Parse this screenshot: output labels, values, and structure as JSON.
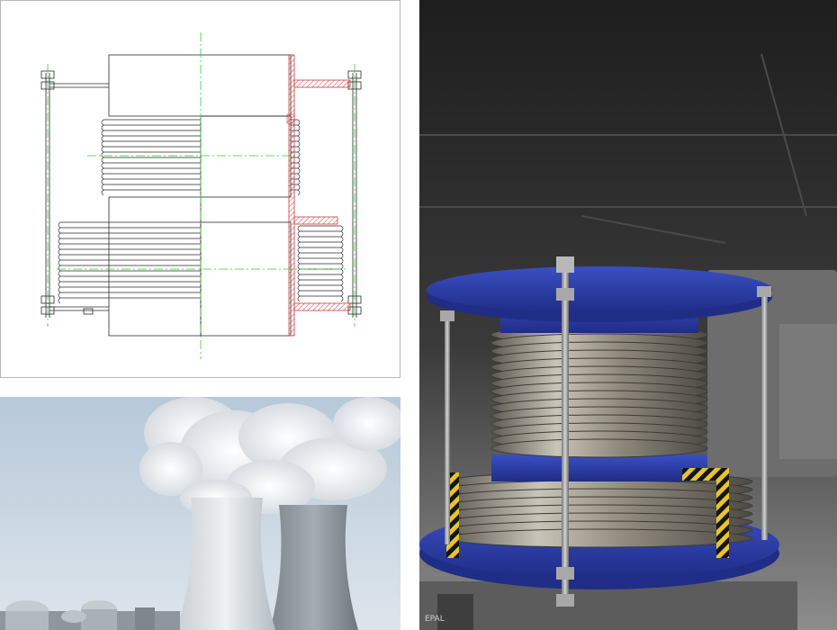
{
  "panels": {
    "drawing": {
      "kind": "technical-drawing",
      "subject": "hinged-expansion-joint-section"
    },
    "towers": {
      "kind": "photo",
      "subject": "cooling-towers"
    },
    "product": {
      "kind": "photo",
      "subject": "expansion-joint-on-pallet"
    }
  },
  "colors": {
    "frame_gray": "#b8b8b8",
    "line_black": "#2a2a2a",
    "centerline_green": "#33cc33",
    "section_red": "#d23a3a",
    "flange_blue": "#2a3ea8",
    "bellows_steel": "#9a9a9a",
    "sky": "#c9d6e2",
    "steam": "#f2f2f2",
    "hazard_yellow": "#e7c52a"
  },
  "pallet": {
    "stamp": "EPAL"
  }
}
